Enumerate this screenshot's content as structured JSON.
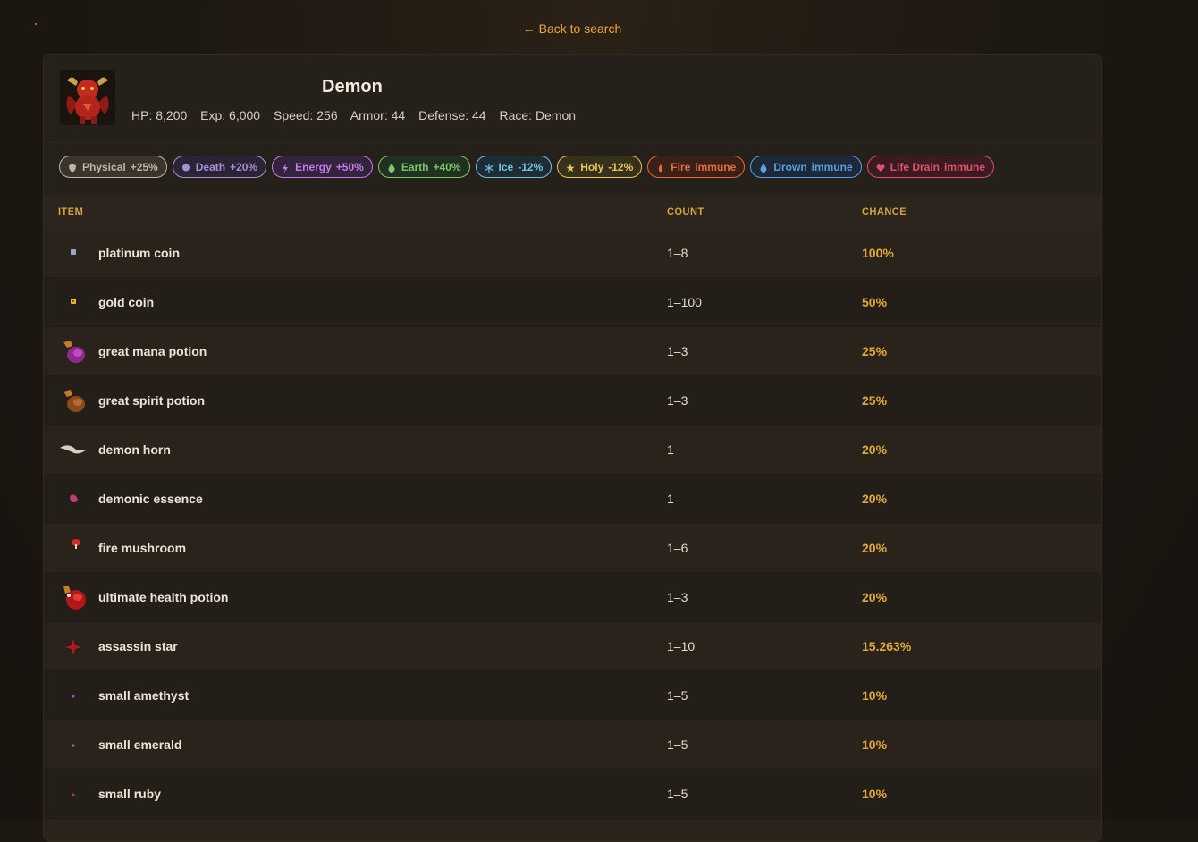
{
  "nav": {
    "back_label": "← Back to search"
  },
  "monster": {
    "name": "Demon",
    "stats": [
      "HP: 8,200",
      "Exp: 6,000",
      "Speed: 256",
      "Armor: 44",
      "Defense: 44",
      "Race: Demon"
    ]
  },
  "elements": [
    {
      "name": "Physical",
      "value": "+25%",
      "icon": "shield-icon",
      "color": "#bdb5a8",
      "bg": "#3a342c"
    },
    {
      "name": "Death",
      "value": "+20%",
      "icon": "skull-icon",
      "color": "#a98fd6",
      "bg": "#2b2436"
    },
    {
      "name": "Energy",
      "value": "+50%",
      "icon": "lightning-icon",
      "color": "#c27ee8",
      "bg": "#33233d"
    },
    {
      "name": "Earth",
      "value": "+40%",
      "icon": "drop-icon",
      "color": "#78c768",
      "bg": "#223021"
    },
    {
      "name": "Ice",
      "value": "-12%",
      "icon": "snowflake-icon",
      "color": "#6fc4e6",
      "bg": "#1e2d34"
    },
    {
      "name": "Holy",
      "value": "-12%",
      "icon": "star-icon",
      "color": "#e6c75a",
      "bg": "#37301b"
    },
    {
      "name": "Fire",
      "value": "immune",
      "icon": "flame-icon",
      "color": "#e86a3c",
      "bg": "#3a2117"
    },
    {
      "name": "Drown",
      "value": "immune",
      "icon": "water-drop-icon",
      "color": "#5a9fe0",
      "bg": "#1d2838"
    },
    {
      "name": "Life Drain",
      "value": "immune",
      "icon": "heart-icon",
      "color": "#e0506a",
      "bg": "#3a1b22"
    }
  ],
  "table": {
    "headers": {
      "item": "ITEM",
      "count": "COUNT",
      "chance": "CHANCE"
    },
    "rows": [
      {
        "icon": "platinum-coin-icon",
        "name": "platinum coin",
        "count": "1–8",
        "chance": "100%"
      },
      {
        "icon": "gold-coin-icon",
        "name": "gold coin",
        "count": "1–100",
        "chance": "50%"
      },
      {
        "icon": "mana-potion-icon",
        "name": "great mana potion",
        "count": "1–3",
        "chance": "25%"
      },
      {
        "icon": "spirit-potion-icon",
        "name": "great spirit potion",
        "count": "1–3",
        "chance": "25%"
      },
      {
        "icon": "horn-icon",
        "name": "demon horn",
        "count": "1",
        "chance": "20%"
      },
      {
        "icon": "essence-icon",
        "name": "demonic essence",
        "count": "1",
        "chance": "20%"
      },
      {
        "icon": "mushroom-icon",
        "name": "fire mushroom",
        "count": "1–6",
        "chance": "20%"
      },
      {
        "icon": "health-potion-icon",
        "name": "ultimate health potion",
        "count": "1–3",
        "chance": "20%"
      },
      {
        "icon": "assassin-star-icon",
        "name": "assassin star",
        "count": "1–10",
        "chance": "15.263%"
      },
      {
        "icon": "amethyst-icon",
        "name": "small amethyst",
        "count": "1–5",
        "chance": "10%"
      },
      {
        "icon": "emerald-icon",
        "name": "small emerald",
        "count": "1–5",
        "chance": "10%"
      },
      {
        "icon": "ruby-icon",
        "name": "small ruby",
        "count": "1–5",
        "chance": "10%"
      },
      {
        "icon": "",
        "name": "",
        "count": "",
        "chance": ""
      }
    ]
  }
}
